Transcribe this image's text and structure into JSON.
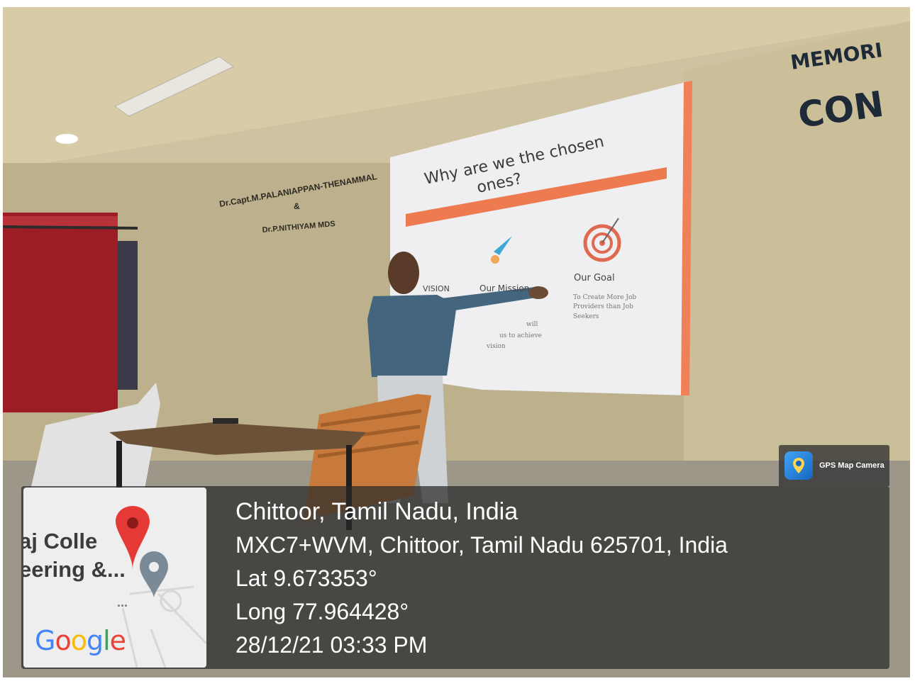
{
  "photo": {
    "wall_sign_memorial": "MEMORI",
    "wall_sign_con": "CON",
    "wall_plaque": {
      "line1": "Dr.Capt.M.PALANIAPPAN-THENAMMAL",
      "line2": "&",
      "line3": "Dr.P.NITHIYAM MDS"
    },
    "slide": {
      "title_line1": "Why are we the chosen",
      "title_line2": "ones?",
      "vision_label": "VISION",
      "mission_label": "Our Mission",
      "mission_text": [
        "will",
        "us to achieve",
        "vision"
      ],
      "goal_label": "Our Goal",
      "goal_text": [
        "To Create More Job",
        "Providers than Job",
        "Seekers"
      ]
    }
  },
  "gps_badge": {
    "label": "GPS Map Camera",
    "icon": "map-pin-icon"
  },
  "info": {
    "location": "Chittoor, Tamil Nadu, India",
    "address": "MXC7+WVM, Chittoor, Tamil Nadu 625701, India",
    "latitude": "Lat 9.673353°",
    "longitude": "Long 77.964428°",
    "datetime": "28/12/21 03:33 PM"
  },
  "map": {
    "place_line1": "aj Colle",
    "place_line2": "eering &...",
    "dots": "...",
    "logo": [
      "G",
      "o",
      "o",
      "g",
      "l",
      "e"
    ],
    "colors": {
      "pin_red": "#e53935",
      "pin_gray": "#7b8a97",
      "logo_blue": "#4285f4",
      "logo_red": "#ea4335",
      "logo_yellow": "#fbbc05",
      "logo_green": "#34a853"
    }
  }
}
